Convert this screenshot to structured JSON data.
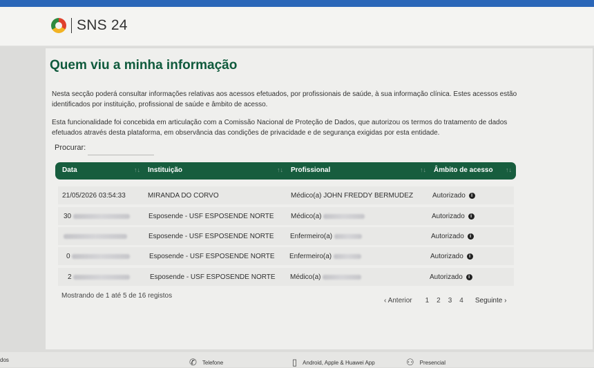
{
  "header": {
    "logo_text": "SNS 24"
  },
  "page": {
    "title": "Quem viu a minha informação",
    "paragraph1": "Nesta secção poderá consultar informações relativas aos acessos efetuados, por profissionais de saúde, à sua informação clínica. Estes acessos estão identificados por instituição, profissional de saúde e âmbito de acesso.",
    "paragraph2": "Esta funcionalidade foi concebida em articulação com a Comissão Nacional de Proteção de Dados, que autorizou os termos do tratamento de dados efetuados através desta plataforma, em observância das condições de privacidade e de segurança exigidas por esta entidade."
  },
  "search": {
    "label": "Procurar:",
    "value": ""
  },
  "table": {
    "columns": [
      "Data",
      "Instituição",
      "Profissional",
      "Âmbito de acesso"
    ],
    "sort_glyph": "↑↓",
    "rows": [
      {
        "date": "21/05/2026 03:54:33",
        "institution": "MIRANDA DO CORVO",
        "professional": "Médico(a) JOHN FREDDY BERMUDEZ",
        "scope": "Autorizado"
      },
      {
        "date": "30",
        "institution": "Esposende - USF ESPOSENDE NORTE",
        "professional": "Médico(a)",
        "scope": "Autorizado"
      },
      {
        "date": "",
        "institution": "Esposende - USF ESPOSENDE NORTE",
        "professional": "Enfermeiro(a)",
        "scope": "Autorizado"
      },
      {
        "date": "0",
        "institution": "Esposende - USF ESPOSENDE NORTE",
        "professional": "Enfermeiro(a)",
        "scope": "Autorizado"
      },
      {
        "date": "2",
        "institution": "Esposende - USF ESPOSENDE NORTE",
        "professional": "Médico(a)",
        "scope": "Autorizado"
      }
    ]
  },
  "records_info": "Mostrando de 1 até 5 de 16 registos",
  "pagination": {
    "previous": "Anterior",
    "pages": [
      "1",
      "2",
      "3",
      "4"
    ],
    "next": "Seguinte"
  },
  "footer": {
    "left_text": "dos",
    "phone": "Telefone",
    "app": "Android, Apple & Huawei App",
    "presencial": "Presencial"
  },
  "colors": {
    "brand_green": "#175d3e",
    "title_green": "#0f5a3c",
    "top_strip": "#2a66b8"
  }
}
